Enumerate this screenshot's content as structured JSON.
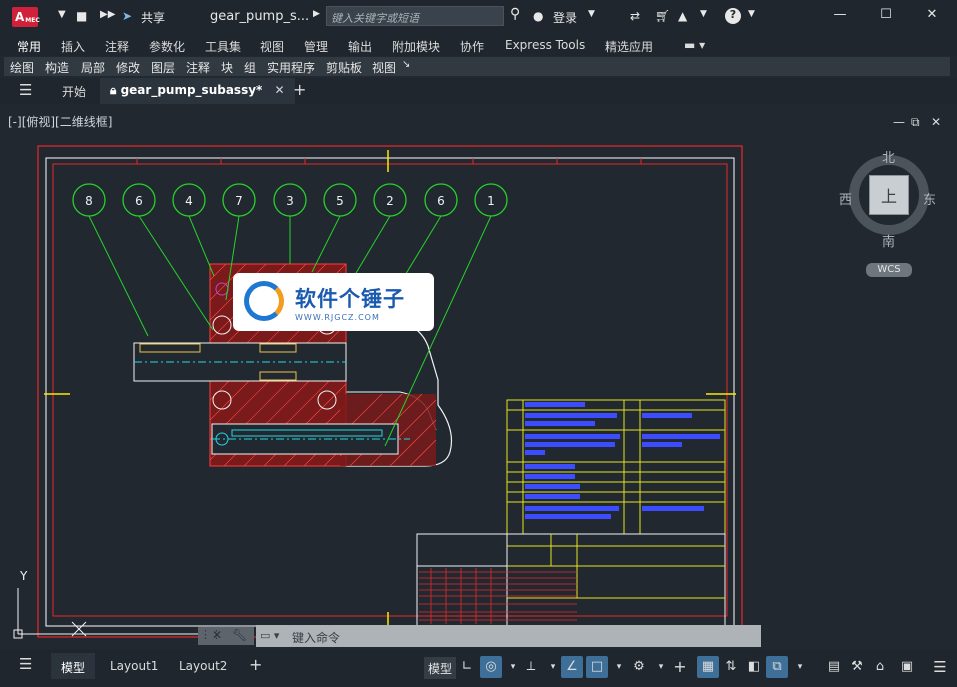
{
  "titlebar": {
    "app_badge": "A",
    "app_badge_sub": "MEC",
    "share_label": "共享",
    "doc_title": "gear_pump_s...",
    "search_placeholder": "键入关键字或短语",
    "login_label": "登录"
  },
  "ribbon": {
    "tabs": [
      {
        "label": "常用",
        "active": true
      },
      {
        "label": "插入"
      },
      {
        "label": "注释"
      },
      {
        "label": "参数化"
      },
      {
        "label": "工具集"
      },
      {
        "label": "视图"
      },
      {
        "label": "管理"
      },
      {
        "label": "输出"
      },
      {
        "label": "附加模块"
      },
      {
        "label": "协作"
      },
      {
        "label": "Express Tools"
      },
      {
        "label": "精选应用"
      }
    ],
    "panels": [
      "绘图",
      "构造",
      "局部",
      "修改",
      "图层",
      "注释",
      "块",
      "组",
      "实用程序",
      "剪贴板",
      "视图"
    ]
  },
  "filetabs": {
    "start_label": "开始",
    "active_label": "gear_pump_subassy*"
  },
  "viewport": {
    "label": "[-][俯视][二维线框]"
  },
  "viewcube": {
    "north": "北",
    "south": "南",
    "east": "东",
    "west": "西",
    "face": "上",
    "wcs": "WCS"
  },
  "balloons": [
    "8",
    "6",
    "4",
    "7",
    "3",
    "5",
    "2",
    "6",
    "1"
  ],
  "watermark": {
    "text": "软件个锤子",
    "url": "WWW.RJGCZ.COM"
  },
  "axis": {
    "y": "Y"
  },
  "command": {
    "placeholder": "键入命令"
  },
  "statusbar": {
    "tabs": [
      {
        "label": "模型",
        "active": true
      },
      {
        "label": "Layout1"
      },
      {
        "label": "Layout2"
      }
    ],
    "model_label": "模型"
  },
  "colors": {
    "border_red": "#e8282a",
    "balloon_green": "#27d22a",
    "table_yellow": "#e4e51e",
    "text_blue": "#3c4cff",
    "accent": "#2b86c5"
  }
}
